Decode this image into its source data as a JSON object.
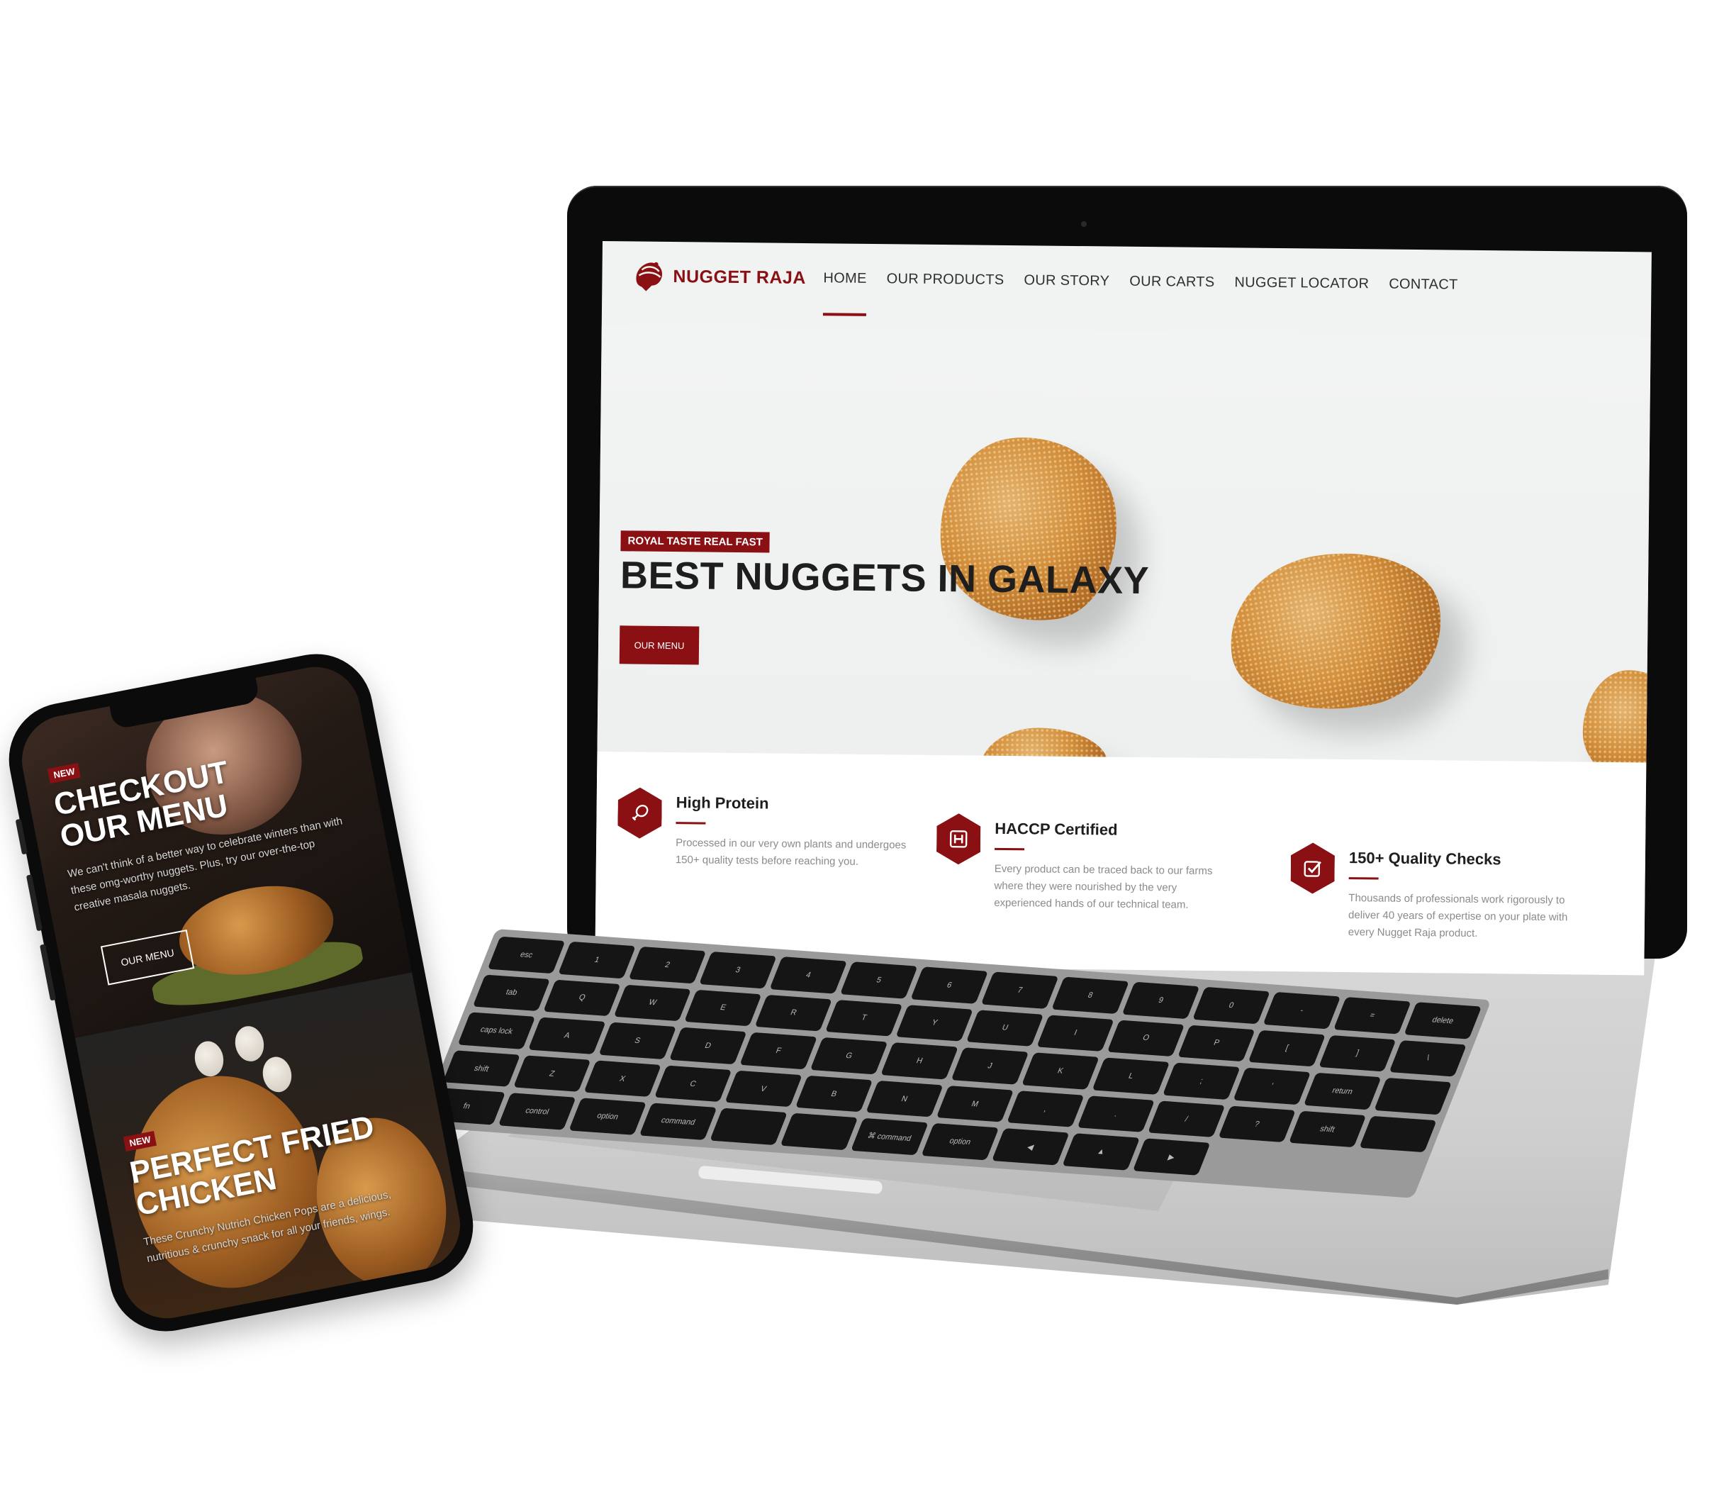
{
  "colors": {
    "brand_red": "#8a1014",
    "text_dark": "#1e1e1e",
    "text_muted": "#8b8b8b",
    "screen_bg": "#f1f2f2"
  },
  "laptop": {
    "site": {
      "brand": {
        "name": "NUGGET RAJA",
        "logo_icon": "turban-logo-icon"
      },
      "nav": {
        "items": [
          "HOME",
          "OUR PRODUCTS",
          "OUR STORY",
          "OUR CARTS",
          "NUGGET LOCATOR",
          "CONTACT"
        ],
        "active": "HOME"
      },
      "hero": {
        "tag": "ROYAL TASTE REAL FAST",
        "title": "BEST NUGGETS IN GALAXY",
        "button": "OUR MENU"
      },
      "features": [
        {
          "icon": "drumstick-icon",
          "title": "High Protein",
          "text": "Processed in our very own plants and undergoes 150+ quality tests before reaching you."
        },
        {
          "icon": "hospital-h-icon",
          "title": "HACCP Certified",
          "text": "Every product can be traced back to our farms where they were nourished by the very experienced hands of our technical team."
        },
        {
          "icon": "check-box-icon",
          "title": "150+ Quality Checks",
          "text": "Thousands of professionals work rigorously to deliver 40 years of expertise on your plate with every Nugget Raja product."
        }
      ]
    },
    "keyboard": {
      "keys": [
        "esc",
        "1",
        "2",
        "3",
        "4",
        "5",
        "6",
        "7",
        "8",
        "9",
        "0",
        "-",
        "=",
        "delete",
        "tab",
        "Q",
        "W",
        "E",
        "R",
        "T",
        "Y",
        "U",
        "I",
        "O",
        "P",
        "[",
        "]",
        "\\",
        "caps lock",
        "A",
        "S",
        "D",
        "F",
        "G",
        "H",
        "J",
        "K",
        "L",
        ";",
        "'",
        "return",
        "",
        "shift",
        "Z",
        "X",
        "C",
        "V",
        "B",
        "N",
        "M",
        ",",
        ".",
        "/",
        "?",
        "shift",
        "",
        "fn",
        "control",
        "option",
        "command",
        "",
        "",
        "⌘ command",
        "option",
        "◀",
        "▲",
        "▶"
      ]
    }
  },
  "phone": {
    "section1": {
      "badge": "NEW",
      "title": "CHECKOUT OUR MENU",
      "text": "We can't think of a better way to celebrate winters than with these omg-worthy nuggets. Plus, try our over-the-top creative masala nuggets.",
      "button": "OUR MENU"
    },
    "section2": {
      "badge": "NEW",
      "title": "PERFECT FRIED CHICKEN",
      "text": "These Crunchy Nutrich Chicken Pops are a delicious, nutritious & crunchy snack for all your friends, wings."
    }
  }
}
